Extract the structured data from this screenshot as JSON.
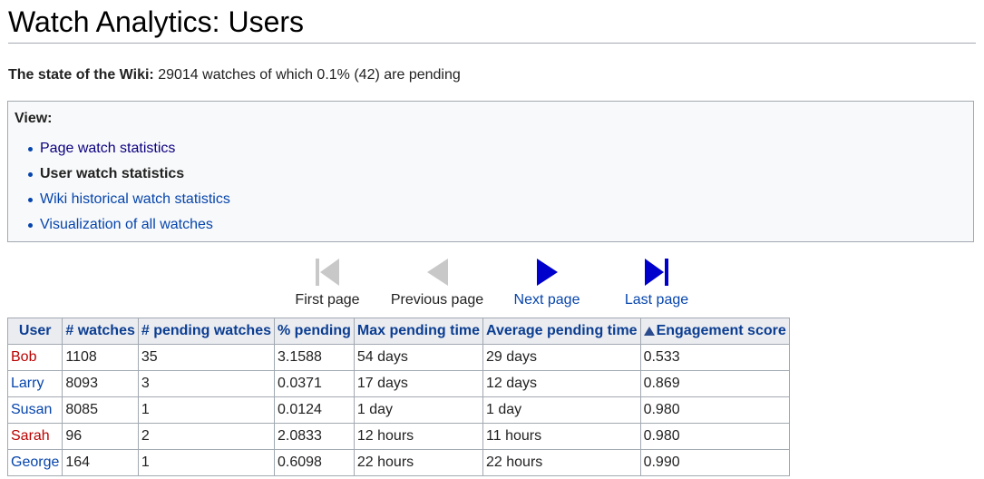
{
  "header": {
    "title": "Watch Analytics: Users"
  },
  "state": {
    "label": "The state of the Wiki:",
    "text": " 29014 watches of which 0.1% (42) are pending"
  },
  "view": {
    "heading": "View:",
    "items": [
      {
        "label": "Page watch statistics",
        "kind": "link"
      },
      {
        "label": "User watch statistics",
        "kind": "current"
      },
      {
        "label": "Wiki historical watch statistics",
        "kind": "link"
      },
      {
        "label": "Visualization of all watches",
        "kind": "link"
      }
    ]
  },
  "pager": {
    "first": {
      "label": "First page",
      "icon": "skip-to-start-icon",
      "enabled": false
    },
    "previous": {
      "label": "Previous page",
      "icon": "play-left-icon",
      "enabled": false
    },
    "next": {
      "label": "Next page",
      "icon": "play-right-icon",
      "enabled": true
    },
    "last": {
      "label": "Last page",
      "icon": "skip-to-end-icon",
      "enabled": true
    },
    "colors": {
      "enabled": "#0000cc",
      "disabled": "#c8c8c8"
    }
  },
  "table": {
    "columns": [
      "User",
      "# watches",
      "# pending watches",
      "% pending",
      "Max pending time",
      "Average pending time",
      "Engagement score"
    ],
    "sorted_column": "Engagement score",
    "sort_direction": "ascending",
    "rows": [
      {
        "user": "Bob",
        "user_link_color": "red",
        "watches": "1108",
        "pending": "35",
        "pct": "3.1588",
        "max": "54 days",
        "avg": "29 days",
        "score": "0.533"
      },
      {
        "user": "Larry",
        "user_link_color": "blue",
        "watches": "8093",
        "pending": "3",
        "pct": "0.0371",
        "max": "17 days",
        "avg": "12 days",
        "score": "0.869"
      },
      {
        "user": "Susan",
        "user_link_color": "blue",
        "watches": "8085",
        "pending": "1",
        "pct": "0.0124",
        "max": "1 day",
        "avg": "1 day",
        "score": "0.980"
      },
      {
        "user": "Sarah",
        "user_link_color": "red",
        "watches": "96",
        "pending": "2",
        "pct": "2.0833",
        "max": "12 hours",
        "avg": "11 hours",
        "score": "0.980"
      },
      {
        "user": "George",
        "user_link_color": "blue",
        "watches": "164",
        "pending": "1",
        "pct": "0.6098",
        "max": "22 hours",
        "avg": "22 hours",
        "score": "0.990"
      }
    ]
  }
}
